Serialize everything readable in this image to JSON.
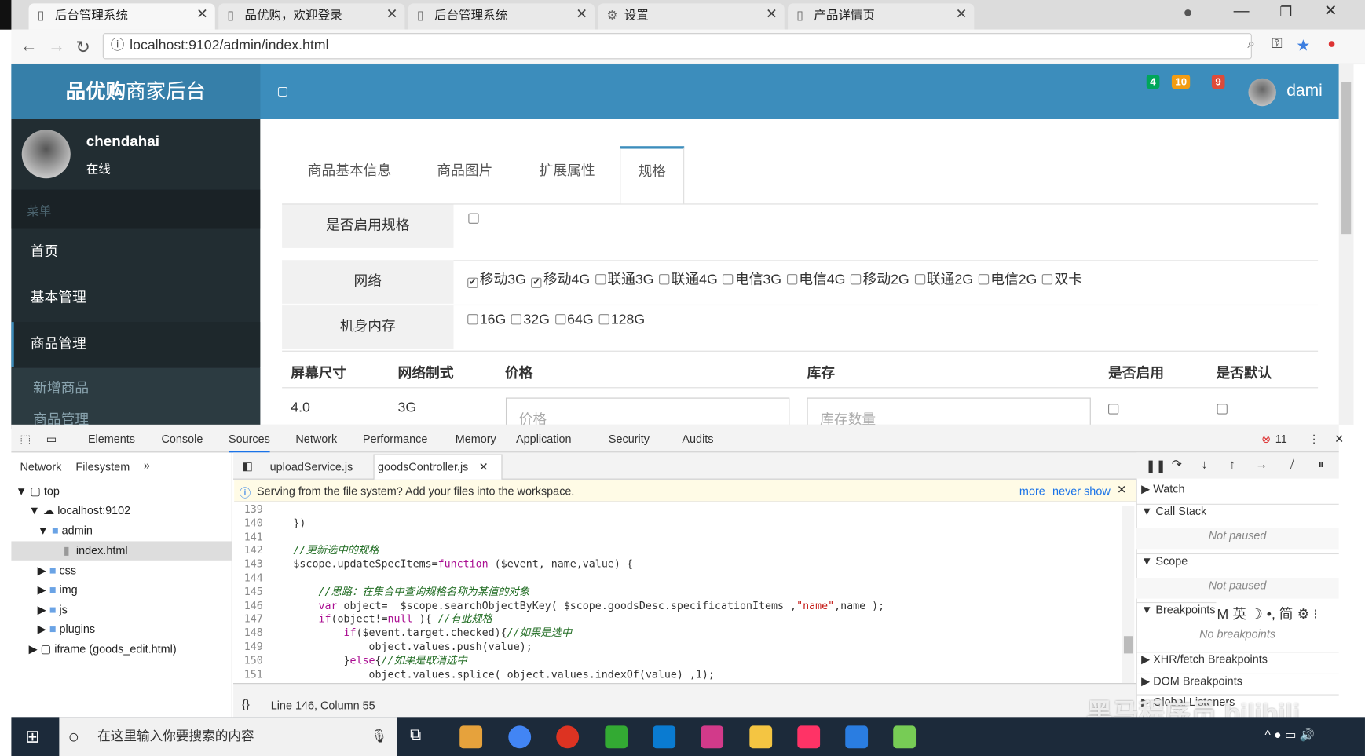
{
  "browser": {
    "tabs": [
      {
        "title": "后台管理系统",
        "active": true
      },
      {
        "title": "品优购，欢迎登录"
      },
      {
        "title": "后台管理系统"
      },
      {
        "title": "设置"
      },
      {
        "title": "产品详情页"
      }
    ],
    "url": "localhost:9102/admin/index.html"
  },
  "header": {
    "logo_bold": "品优购",
    "logo_rest": "商家后台",
    "badges": [
      {
        "value": "4",
        "color": "#00a65a"
      },
      {
        "value": "10",
        "color": "#f39c12"
      },
      {
        "value": "9",
        "color": "#dd4b39"
      }
    ],
    "username": "dami"
  },
  "sidebar": {
    "user": "chendahai",
    "status": "在线",
    "menu_header": "菜单",
    "items": [
      "首页",
      "基本管理",
      "商品管理"
    ],
    "subitems": [
      "新增商品",
      "商品管理"
    ]
  },
  "content": {
    "tabs": [
      "商品基本信息",
      "商品图片",
      "扩展属性",
      "规格"
    ],
    "active_tab": "规格",
    "enable_spec_label": "是否启用规格",
    "network_label": "网络",
    "network_options": [
      {
        "label": "移动3G",
        "checked": true
      },
      {
        "label": "移动4G",
        "checked": true
      },
      {
        "label": "联通3G"
      },
      {
        "label": "联通4G"
      },
      {
        "label": "电信3G"
      },
      {
        "label": "电信4G"
      },
      {
        "label": "移动2G"
      },
      {
        "label": "联通2G"
      },
      {
        "label": "电信2G"
      },
      {
        "label": "双卡"
      }
    ],
    "memory_label": "机身内存",
    "memory_options": [
      {
        "label": "16G"
      },
      {
        "label": "32G"
      },
      {
        "label": "64G"
      },
      {
        "label": "128G"
      }
    ],
    "table_headers": [
      "屏幕尺寸",
      "网络制式",
      "价格",
      "库存",
      "是否启用",
      "是否默认"
    ],
    "row": {
      "screen": "4.0",
      "network": "3G",
      "price_placeholder": "价格",
      "stock_placeholder": "库存数量"
    }
  },
  "devtools": {
    "tabs": [
      "Elements",
      "Console",
      "Sources",
      "Network",
      "Performance",
      "Memory",
      "Application",
      "Security",
      "Audits"
    ],
    "active_tab": "Sources",
    "error_count": "11",
    "nav_tabs": [
      "Network",
      "Filesystem"
    ],
    "tree": [
      "top",
      "localhost:9102",
      "admin",
      "index.html",
      "css",
      "img",
      "js",
      "plugins",
      "iframe (goods_edit.html)"
    ],
    "files": [
      "uploadService.js",
      "goodsController.js"
    ],
    "infobar": {
      "text": "Serving from the file system? Add your files into the workspace.",
      "more": "more",
      "never": "never show"
    },
    "line_numbers": [
      "139",
      "140",
      "141",
      "142",
      "143",
      "144",
      "145",
      "146",
      "147",
      "148",
      "149",
      "150",
      "151"
    ],
    "code": [
      "",
      "    })",
      "",
      "    //更新选中的规格",
      "    $scope.updateSpecItems=function ($event, name,value) {",
      "",
      "        //思路：在集合中查询规格名称为某值的对象",
      "        var object=  $scope.searchObjectByKey( $scope.goodsDesc.specificationItems ,\"name\",name );",
      "        if(object!=null ){ //有此规格",
      "            if($event.target.checked){//如果是选中",
      "                object.values.push(value);",
      "            }else{//如果是取消选中",
      "                object.values.splice( object.values.indexOf(value) ,1);"
    ],
    "status": "Line 146, Column 55",
    "right": {
      "watch": "Watch",
      "callstack": "Call Stack",
      "not_paused": "Not paused",
      "scope": "Scope",
      "breakpoints": "Breakpoints",
      "no_breakpoints": "No breakpoints",
      "xhr": "XHR/fetch Breakpoints",
      "dom": "DOM Breakpoints",
      "global": "Global Listeners"
    }
  },
  "taskbar": {
    "search_placeholder": "在这里输入你要搜索的内容"
  },
  "watermark": "黑马程序员 bilibili"
}
